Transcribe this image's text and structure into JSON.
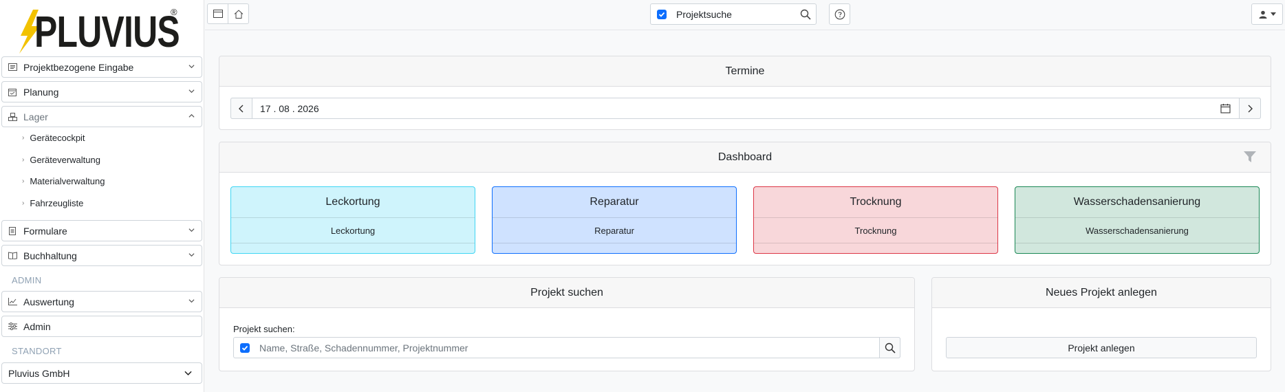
{
  "brand": {
    "logo_text": "PLUVIUS",
    "registered": "®"
  },
  "sidebar": {
    "items": [
      {
        "label": "Projektbezogene Eingabe",
        "icon": "form-icon",
        "expanded": false
      },
      {
        "label": "Planung",
        "icon": "calendar-check-icon",
        "expanded": false
      },
      {
        "label": "Lager",
        "icon": "boxes-icon",
        "expanded": true
      },
      {
        "label": "Formulare",
        "icon": "document-icon",
        "expanded": false
      },
      {
        "label": "Buchhaltung",
        "icon": "book-icon",
        "expanded": false
      }
    ],
    "lager_sub": [
      "Gerätecockpit",
      "Geräteverwaltung",
      "Materialverwaltung",
      "Fahrzeugliste"
    ],
    "admin_label": "ADMIN",
    "admin_items": [
      {
        "label": "Auswertung",
        "icon": "chart-line-icon"
      },
      {
        "label": "Admin",
        "icon": "sliders-icon"
      }
    ],
    "standort_label": "STANDORT",
    "standort_value": "Pluvius GmbH"
  },
  "topbar": {
    "search_label": "Projektsuche",
    "search_checked": true,
    "icons": [
      "window-icon",
      "home-icon",
      "search-icon",
      "help-icon",
      "user-icon"
    ]
  },
  "termine": {
    "title": "Termine",
    "date": "17 . 08 . 2026"
  },
  "dashboard": {
    "title": "Dashboard",
    "cards": [
      {
        "title": "Leckortung",
        "body": "Leckortung",
        "bg": "#cff4fc",
        "border": "#3dd5f3"
      },
      {
        "title": "Reparatur",
        "body": "Reparatur",
        "bg": "#cfe2ff",
        "border": "#0d6efd"
      },
      {
        "title": "Trocknung",
        "body": "Trocknung",
        "bg": "#f8d7da",
        "border": "#dc3545"
      },
      {
        "title": "Wasserschadensanierung",
        "body": "Wasserschadensanierung",
        "bg": "#d1e7dd",
        "border": "#198754"
      }
    ]
  },
  "projekt_suchen": {
    "title": "Projekt suchen",
    "label": "Projekt suchen:",
    "placeholder": "Name, Straße, Schadennummer, Projektnummer",
    "checked": true
  },
  "neues_projekt": {
    "title": "Neues Projekt anlegen",
    "button": "Projekt anlegen"
  },
  "colors": {
    "accent": "#0d6efd",
    "bolt": "#f2c200"
  }
}
